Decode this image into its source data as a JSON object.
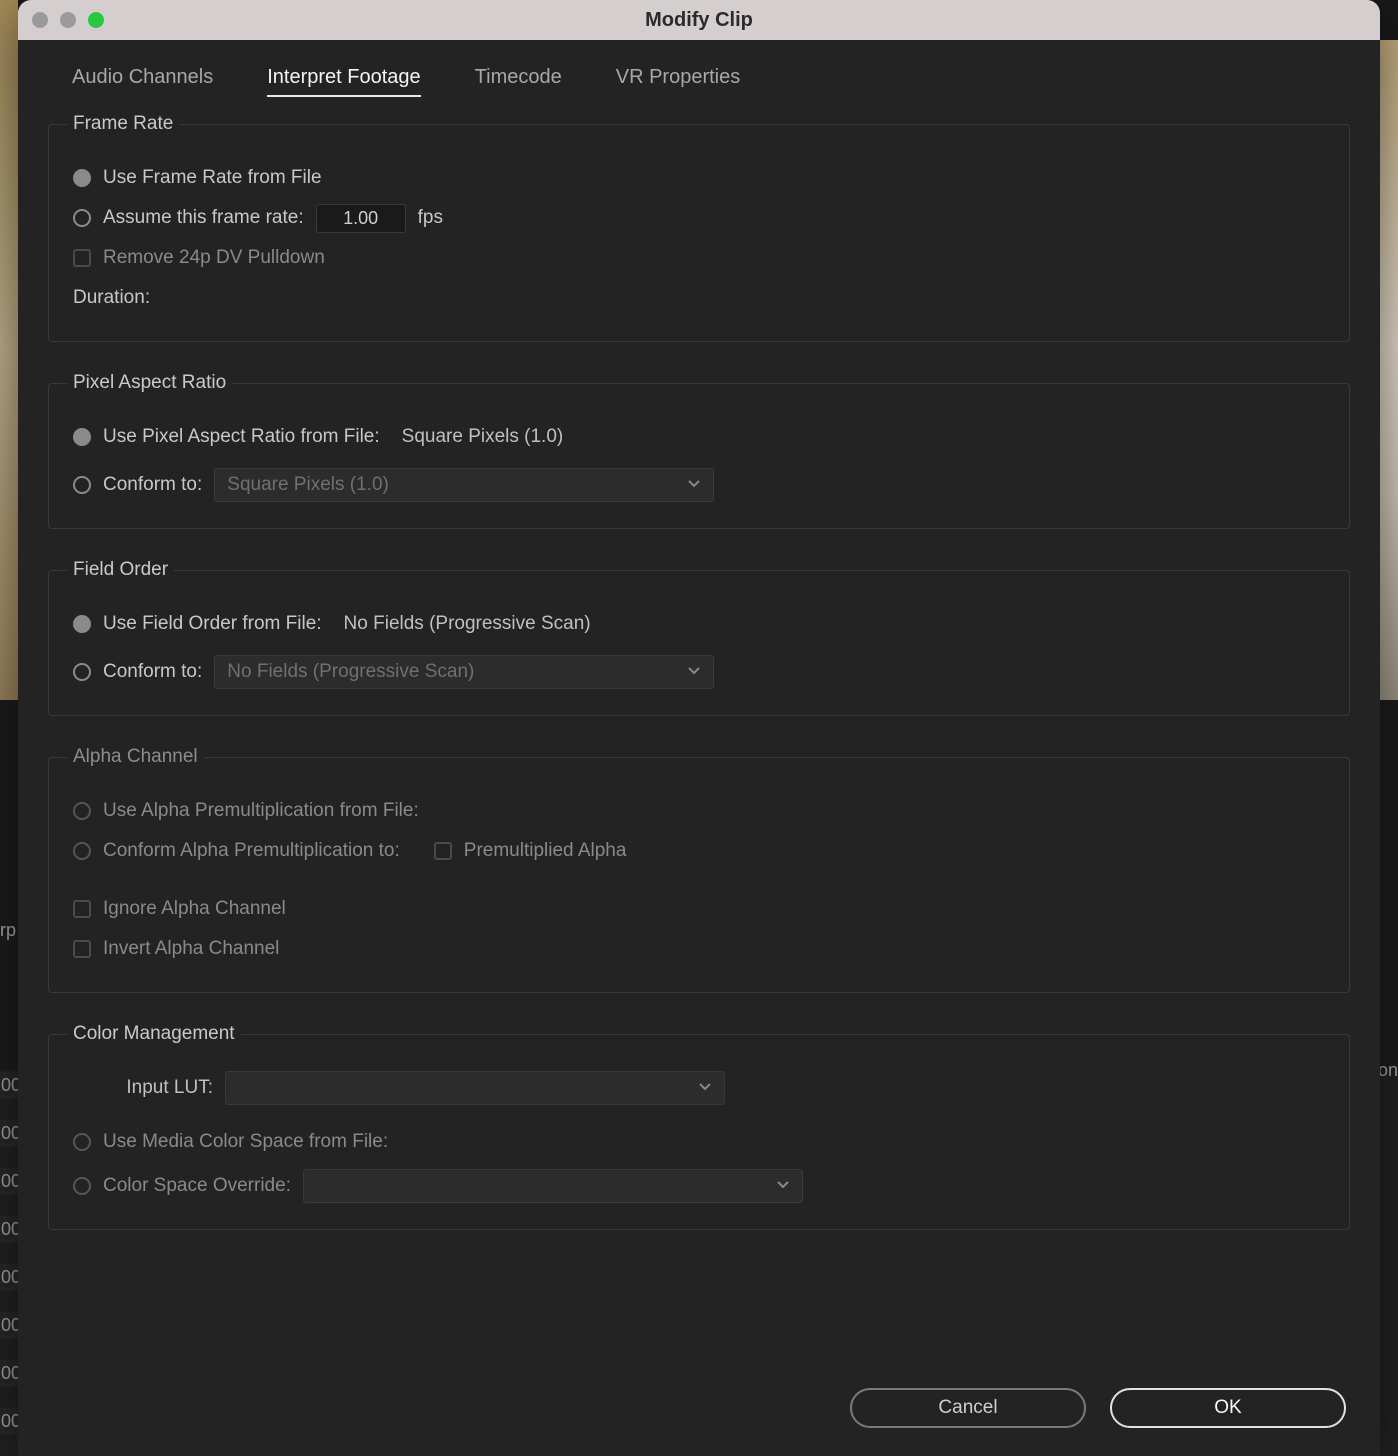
{
  "window": {
    "title": "Modify Clip"
  },
  "tabs": {
    "audio": "Audio Channels",
    "interpret": "Interpret Footage",
    "timecode": "Timecode",
    "vr": "VR Properties"
  },
  "frameRate": {
    "legend": "Frame Rate",
    "useFromFile": "Use Frame Rate from File",
    "assumeLabel": "Assume this frame rate:",
    "assumeValue": "1.00",
    "fps": "fps",
    "removePulldown": "Remove 24p DV Pulldown",
    "durationLabel": "Duration:"
  },
  "pixelAspect": {
    "legend": "Pixel Aspect Ratio",
    "useFromFile": "Use Pixel Aspect Ratio from File:",
    "fromFileValue": "Square Pixels (1.0)",
    "conformLabel": "Conform to:",
    "conformValue": "Square Pixels (1.0)"
  },
  "fieldOrder": {
    "legend": "Field Order",
    "useFromFile": "Use Field Order from File:",
    "fromFileValue": "No Fields (Progressive Scan)",
    "conformLabel": "Conform to:",
    "conformValue": "No Fields (Progressive Scan)"
  },
  "alpha": {
    "legend": "Alpha Channel",
    "useFromFile": "Use Alpha Premultiplication from File:",
    "conformLabel": "Conform Alpha Premultiplication to:",
    "premultLabel": "Premultiplied Alpha",
    "ignore": "Ignore Alpha Channel",
    "invert": "Invert Alpha Channel"
  },
  "colorMgmt": {
    "legend": "Color Management",
    "inputLUT": "Input LUT:",
    "useFromFile": "Use Media Color Space from File:",
    "overrideLabel": "Color Space Override:"
  },
  "buttons": {
    "cancel": "Cancel",
    "ok": "OK"
  },
  "background": {
    "leftFrag": "rp",
    "rightFrag": "on",
    "rowNum": "00"
  }
}
